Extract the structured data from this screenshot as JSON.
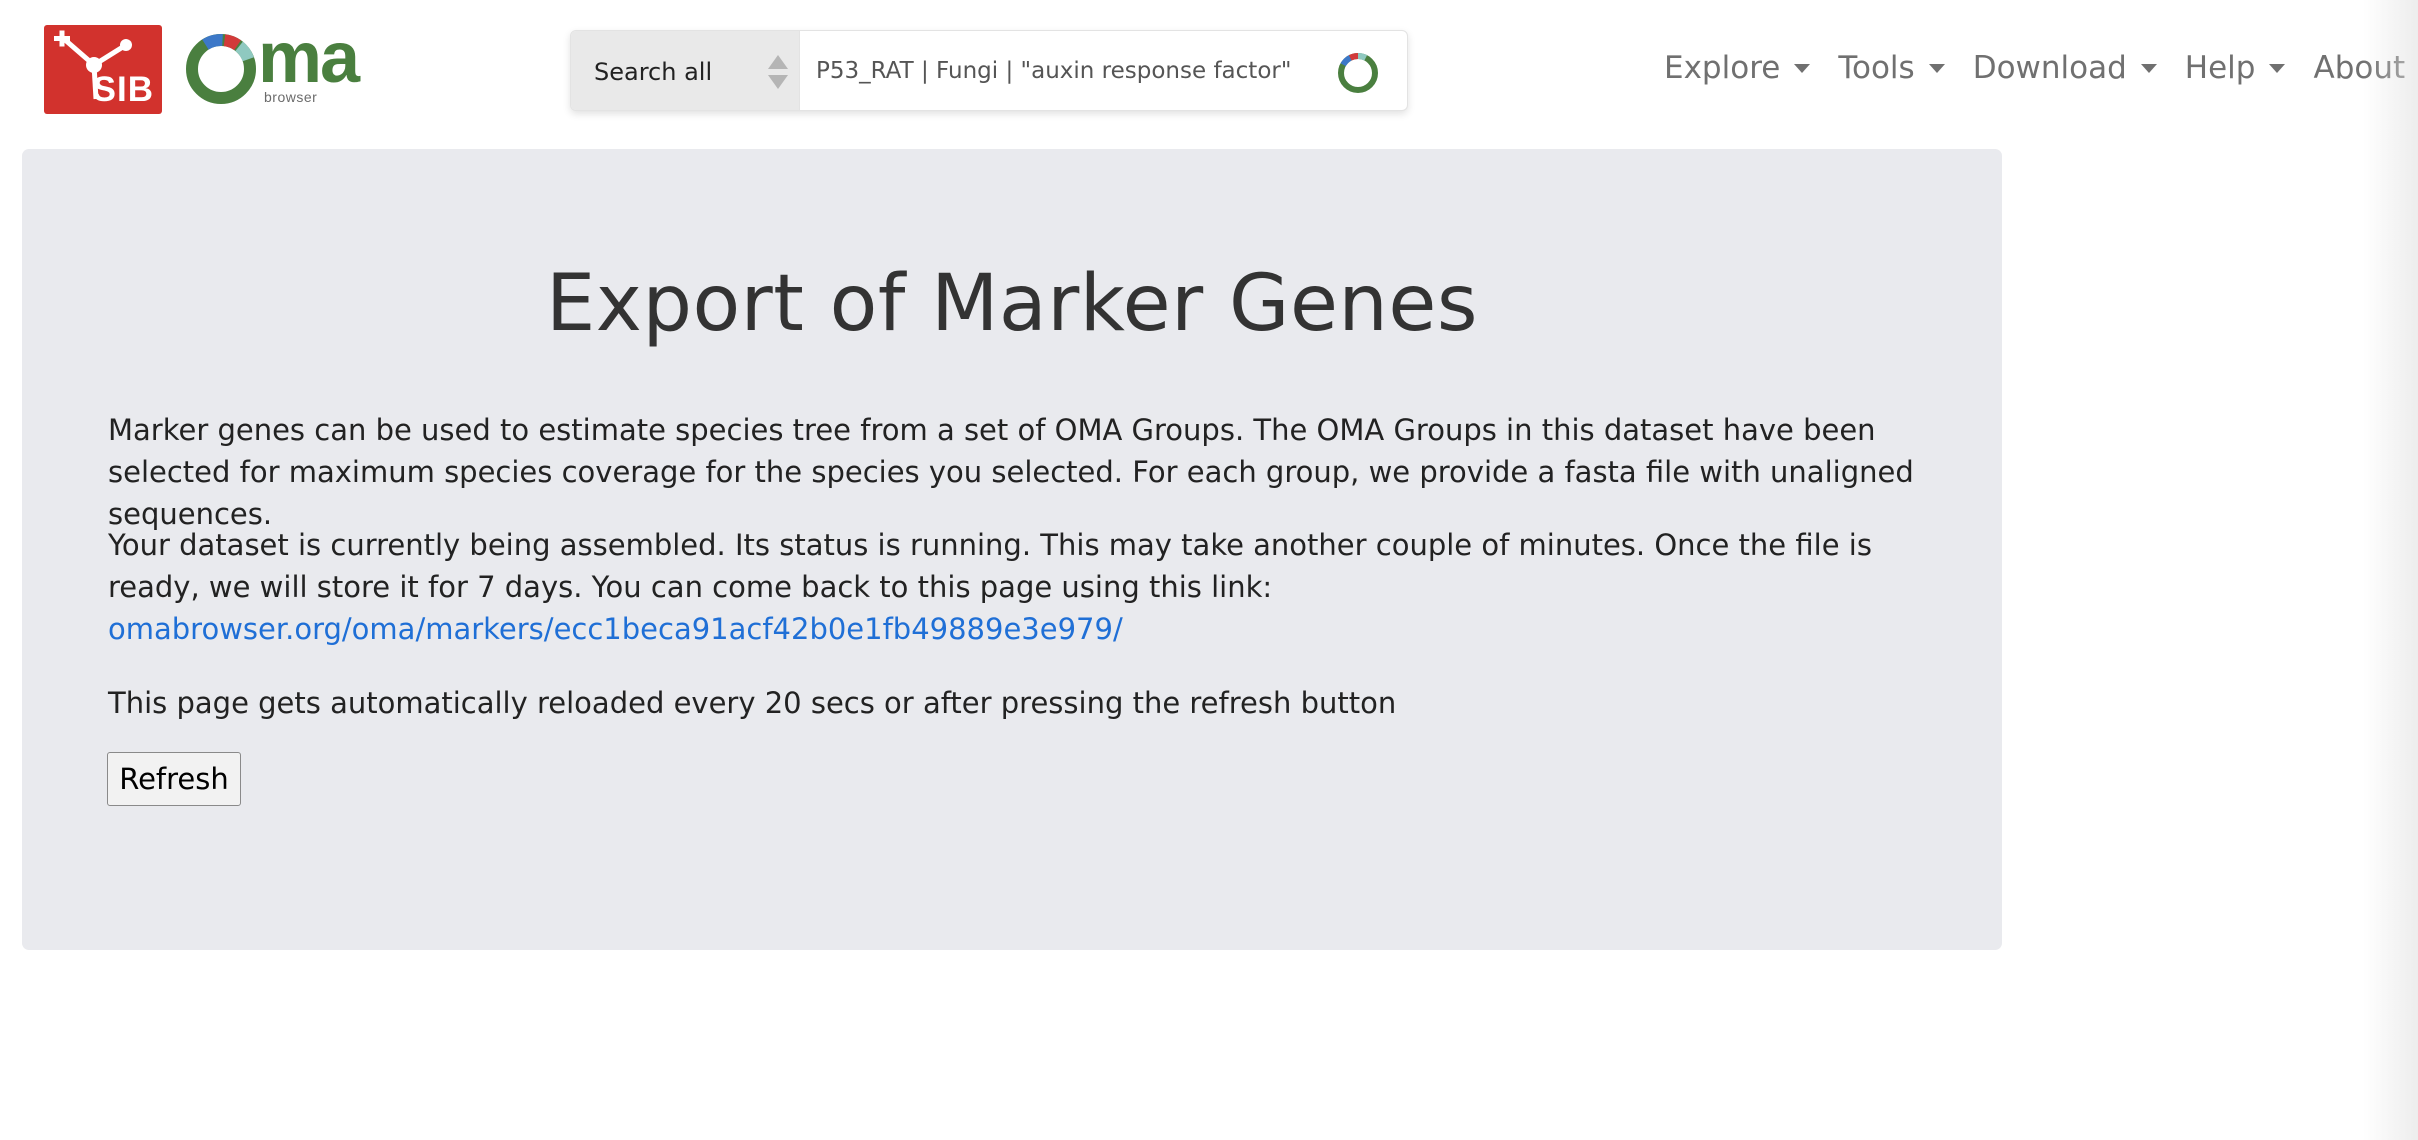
{
  "header": {
    "sib_logo_text": "SIB",
    "oma_logo_text": "ma",
    "oma_logo_subtext": "browser",
    "search": {
      "scope_label": "Search all",
      "placeholder": "P53_RAT | Fungi | \"auxin response factor\""
    },
    "nav": [
      {
        "label": "Explore"
      },
      {
        "label": "Tools"
      },
      {
        "label": "Download"
      },
      {
        "label": "Help"
      },
      {
        "label": "About"
      }
    ]
  },
  "main": {
    "title": "Export of Marker Genes",
    "intro": "Marker genes can be used to estimate species tree from a set of OMA Groups. The OMA Groups in this dataset have been selected for maximum species coverage for the species you selected. For each group, we provide a fasta file with unaligned sequences.",
    "status_prefix": "Your dataset is currently being assembled. Its status is ",
    "status_value": "running",
    "status_suffix": ". This may take another couple of minutes. Once the file is ready, we will store it for 7 days. You can come back to this page using this link:",
    "link_text": "omabrowser.org/oma/markers/ecc1beca91acf42b0e1fb49889e3e979/",
    "reload_note": "This page gets automatically reloaded every 20 secs or after pressing the refresh button",
    "refresh_label": "Refresh"
  },
  "colors": {
    "sib_red": "#d2322d",
    "oma_green": "#4a7f3f",
    "link_blue": "#1f6fd6",
    "panel_bg": "#e9eaee"
  }
}
